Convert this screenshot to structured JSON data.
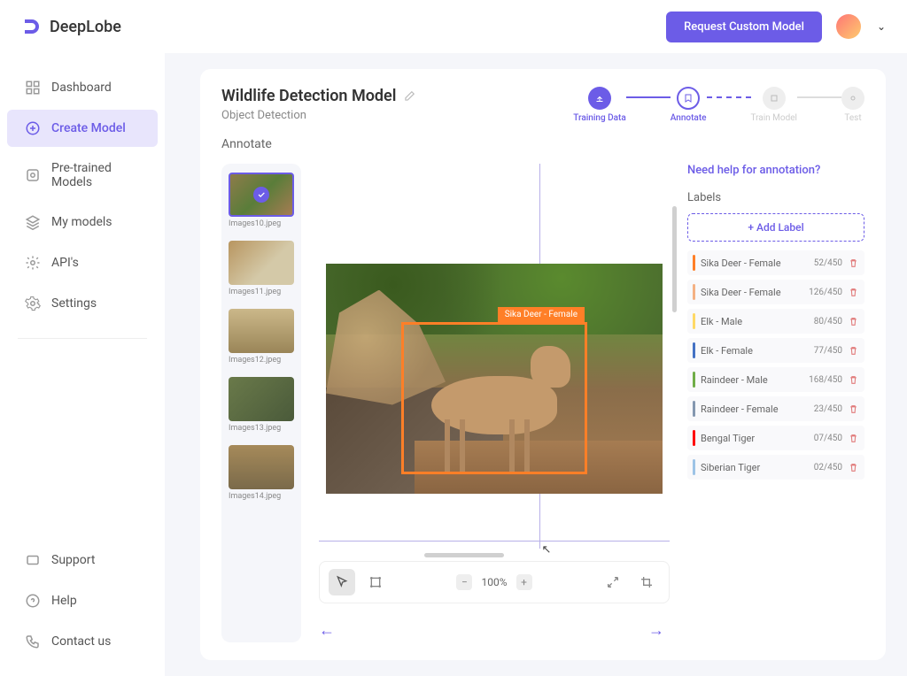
{
  "app": {
    "name": "DeepLobe",
    "request_btn": "Request Custom Model"
  },
  "sidebar": {
    "items": [
      {
        "label": "Dashboard",
        "active": false
      },
      {
        "label": "Create Model",
        "active": true
      },
      {
        "label": "Pre-trained Models",
        "active": false
      },
      {
        "label": "My models",
        "active": false
      },
      {
        "label": "API's",
        "active": false
      },
      {
        "label": "Settings",
        "active": false
      }
    ],
    "bottom_items": [
      {
        "label": "Support"
      },
      {
        "label": "Help"
      },
      {
        "label": "Contact us"
      }
    ]
  },
  "model": {
    "title": "Wildlife Detection Model",
    "subtitle": "Object Detection"
  },
  "stepper": {
    "steps": [
      {
        "label": "Training Data",
        "state": "done"
      },
      {
        "label": "Annotate",
        "state": "active"
      },
      {
        "label": "Train Model",
        "state": "pending"
      },
      {
        "label": "Test",
        "state": "pending"
      }
    ]
  },
  "section_title": "Annotate",
  "thumbs": [
    {
      "label": "Images10.jpeg",
      "selected": true
    },
    {
      "label": "Images11.jpeg",
      "selected": false
    },
    {
      "label": "Images12.jpeg",
      "selected": false
    },
    {
      "label": "Images13.jpeg",
      "selected": false
    },
    {
      "label": "Images14.jpeg",
      "selected": false
    }
  ],
  "annotation": {
    "box_label": "Sika Deer - Female"
  },
  "toolbar": {
    "zoom_value": "100%"
  },
  "labels_panel": {
    "help_text": "Need help for annotation?",
    "title": "Labels",
    "add_btn": "+  Add Label",
    "items": [
      {
        "name": "Sika Deer - Female",
        "count": "52/450",
        "color": "#ff7f27"
      },
      {
        "name": "Sika Deer - Female",
        "count": "126/450",
        "color": "#f4b183"
      },
      {
        "name": "Elk - Male",
        "count": "80/450",
        "color": "#ffd966"
      },
      {
        "name": "Elk - Female",
        "count": "77/450",
        "color": "#4472c4"
      },
      {
        "name": "Raindeer - Male",
        "count": "168/450",
        "color": "#70ad47"
      },
      {
        "name": "Raindeer - Female",
        "count": "23/450",
        "color": "#8497b0"
      },
      {
        "name": "Bengal Tiger",
        "count": "07/450",
        "color": "#ff0000"
      },
      {
        "name": "Siberian Tiger",
        "count": "02/450",
        "color": "#9dc3e6"
      }
    ]
  }
}
